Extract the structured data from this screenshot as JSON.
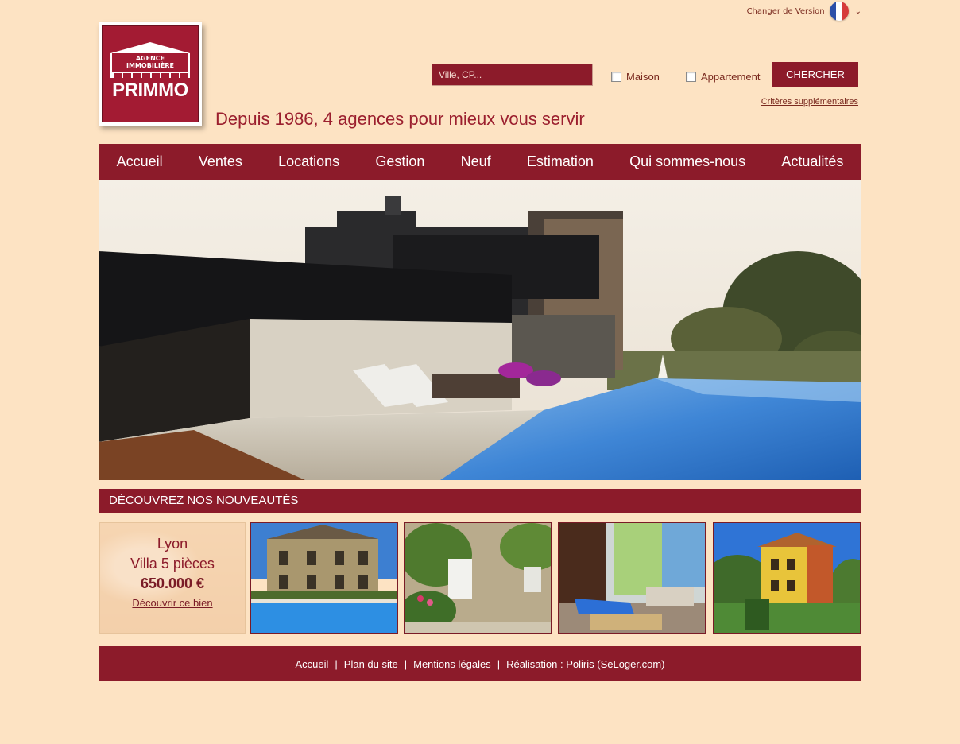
{
  "header": {
    "lang_label": "Changer de Version",
    "flag_icon": "france-flag-icon",
    "logo": {
      "line1": "AGENCE",
      "line2": "IMMOBILIÈRE",
      "name": "PRIMMO"
    },
    "tagline": "Depuis 1986, 4 agences pour mieux vous servir"
  },
  "search": {
    "placeholder": "Ville, CP...",
    "option_maison": "Maison",
    "option_appartement": "Appartement",
    "button_label": "CHERCHER",
    "more_criteria": "Critères supplémentaires"
  },
  "nav": {
    "items": [
      "Accueil",
      "Ventes",
      "Locations",
      "Gestion",
      "Neuf",
      "Estimation",
      "Qui sommes-nous",
      "Actualités"
    ]
  },
  "nouveautes": {
    "title_prefix": "DÉCOUVREZ NOS ",
    "title_strong": "NOUVEAUTÉS",
    "featured": {
      "city": "Lyon",
      "type": "Villa 5 pièces",
      "price": "650.000 €",
      "link": "Découvrir ce bien"
    }
  },
  "footer": {
    "links": [
      "Accueil",
      "Plan du site",
      "Mentions légales",
      "Réalisation : Poliris (SeLoger.com)"
    ]
  },
  "colors": {
    "background": "#fde3c3",
    "brand": "#8c1b2a"
  }
}
